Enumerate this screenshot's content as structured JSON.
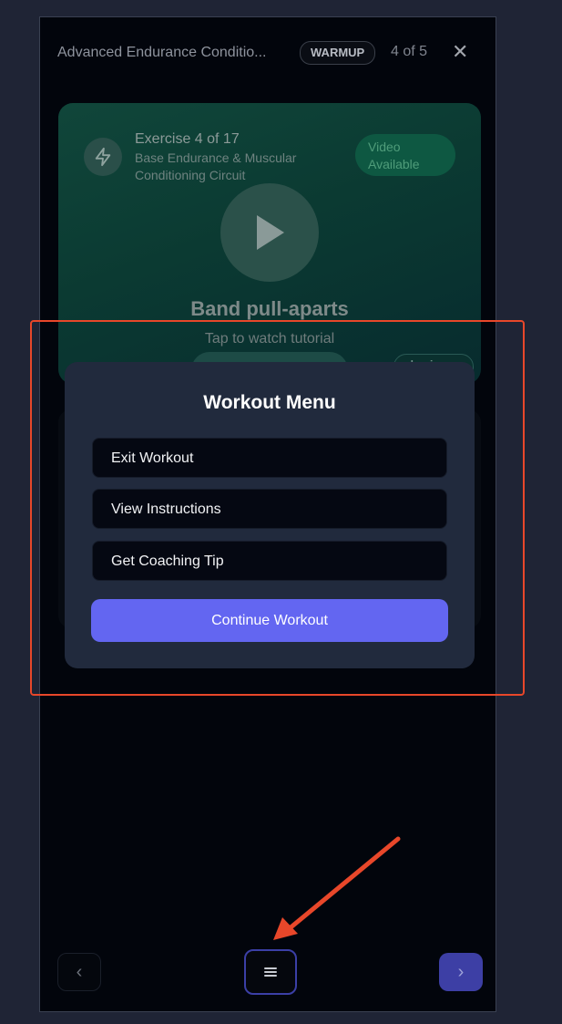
{
  "header": {
    "workout_title": "Advanced Endurance Conditio...",
    "phase_badge": "WARMUP",
    "phase_counter": "4 of 5",
    "close_symbol": "✕"
  },
  "exercise": {
    "number_label": "Exercise 4 of 17",
    "circuit_name": "Base Endurance & Muscular Conditioning Circuit",
    "video_badge": "Video Available",
    "name": "Band pull-aparts",
    "tap_hint": "Tap to watch tutorial",
    "level_badge": "beginner"
  },
  "modal": {
    "title": "Workout Menu",
    "items": [
      {
        "label": "Exit Workout"
      },
      {
        "label": "View Instructions"
      },
      {
        "label": "Get Coaching Tip"
      }
    ],
    "primary_label": "Continue Workout"
  },
  "bottom_nav": {
    "prev_symbol": "‹",
    "next_symbol": "›",
    "menu_icon": "hamburger-icon"
  },
  "colors": {
    "accent": "#6366f1",
    "annotation": "#e8472a"
  }
}
